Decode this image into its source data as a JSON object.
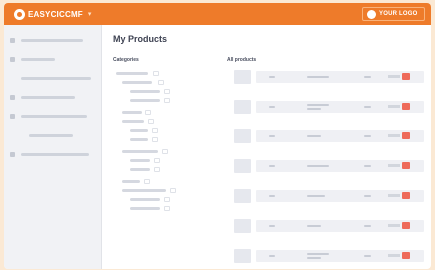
{
  "header": {
    "brand": "EASYCICCMF",
    "logo_label": "YOUR LOGO"
  },
  "page": {
    "title": "My Products",
    "categories_heading": "Categories",
    "products_heading": "All products"
  },
  "colors": {
    "topbar": "#ee7b2a",
    "background": "#fbe9d4",
    "flag": "#ee6a5a"
  }
}
